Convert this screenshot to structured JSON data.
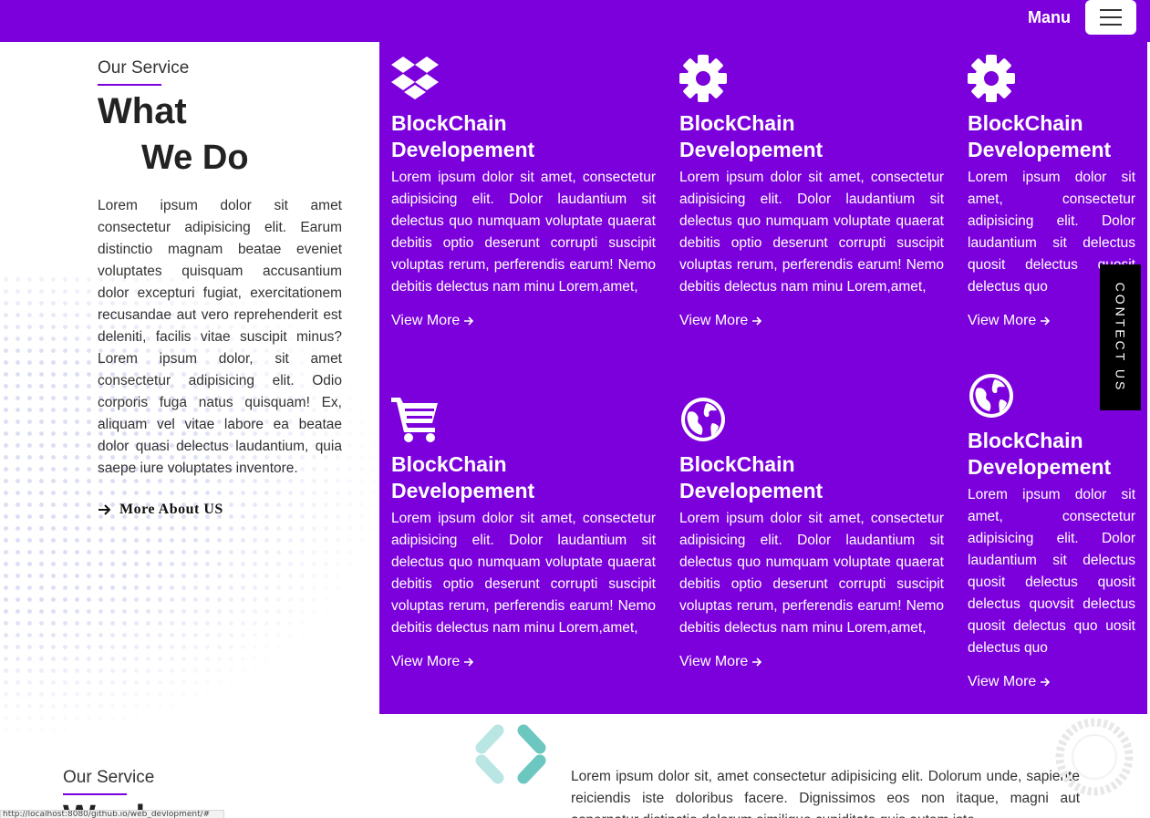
{
  "header": {
    "menu_label": "Manu"
  },
  "intro": {
    "eyebrow": "Our Service",
    "title_line1": "What",
    "title_line2": "We Do",
    "text": "Lorem ipsum dolor sit amet consectetur adipisicing elit. Earum distinctio magnam beatae eveniet voluptates quisquam accusantium dolor excepturi fugiat, exercitationem recusandae aut vero reprehenderit est deleniti, facilis vitae suscipit minus?Lorem ipsum dolor, sit amet consectetur adipisicing elit. Odio corporis fuga natus quisquam! Ex, aliquam vel vitae labore ea beatae dolor quasi delectus laudantium, quia saepe iure voluptates inventore.",
    "more_label": "More About US"
  },
  "services": [
    {
      "icon": "dropbox-icon",
      "title": "BlockChain Developement",
      "text": "Lorem ipsum dolor sit amet, consectetur adipisicing elit. Dolor laudantium sit delectus quo numquam voluptate quaerat debitis optio deserunt corrupti suscipit voluptas rerum, perferendis earum! Nemo debitis delectus nam minu Lorem,amet,",
      "link": "View More"
    },
    {
      "icon": "gear-icon",
      "title": "BlockChain Developement",
      "text": "Lorem ipsum dolor sit amet, consectetur adipisicing elit. Dolor laudantium sit delectus quo numquam voluptate quaerat debitis optio deserunt corrupti suscipit voluptas rerum, perferendis earum! Nemo debitis delectus nam minu Lorem,amet,",
      "link": "View More"
    },
    {
      "icon": "gear-icon",
      "title": "BlockChain Developement",
      "text": "Lorem ipsum dolor sit amet, consectetur adipisicing elit. Dolor laudantium sit delectus quosit delectus quosit delectus quo",
      "link": "View More"
    },
    {
      "icon": "cart-icon",
      "title": "BlockChain Developement",
      "text": "Lorem ipsum dolor sit amet, consectetur adipisicing elit. Dolor laudantium sit delectus quo numquam voluptate quaerat debitis optio deserunt corrupti suscipit voluptas rerum, perferendis earum! Nemo debitis delectus nam minu Lorem,amet,",
      "link": "View More"
    },
    {
      "icon": "globe-icon",
      "title": "BlockChain Developement",
      "text": "Lorem ipsum dolor sit amet, consectetur adipisicing elit. Dolor laudantium sit delectus quo numquam voluptate quaerat debitis optio deserunt corrupti suscipit voluptas rerum, perferendis earum! Nemo debitis delectus nam minu Lorem,amet,",
      "link": "View More"
    },
    {
      "icon": "globe-icon",
      "title": "BlockChain Developement",
      "text": "Lorem ipsum dolor sit amet, consectetur adipisicing elit. Dolor laudantium sit delectus quosit delectus quosit delectus quovsit delectus quosit delectus quo uosit delectus quo",
      "link": "View More"
    }
  ],
  "contact_tab": "CONTECT US",
  "bottom": {
    "eyebrow": "Our Service",
    "title": "We d",
    "text": "Lorem ipsum dolor sit, amet consectetur adipisicing elit. Dolorum unde, sapiente reiciendis iste doloribus facere. Dignissimos eos non itaque, magni aut aspernatur distinctio dolorum similique cupiditate quis autem iste"
  },
  "status_url": "http://localhost:8080/github.io/web_devlopment/#",
  "colors": {
    "brand_purple": "#7b00dc",
    "logo_teal": "#6cc7c0"
  }
}
